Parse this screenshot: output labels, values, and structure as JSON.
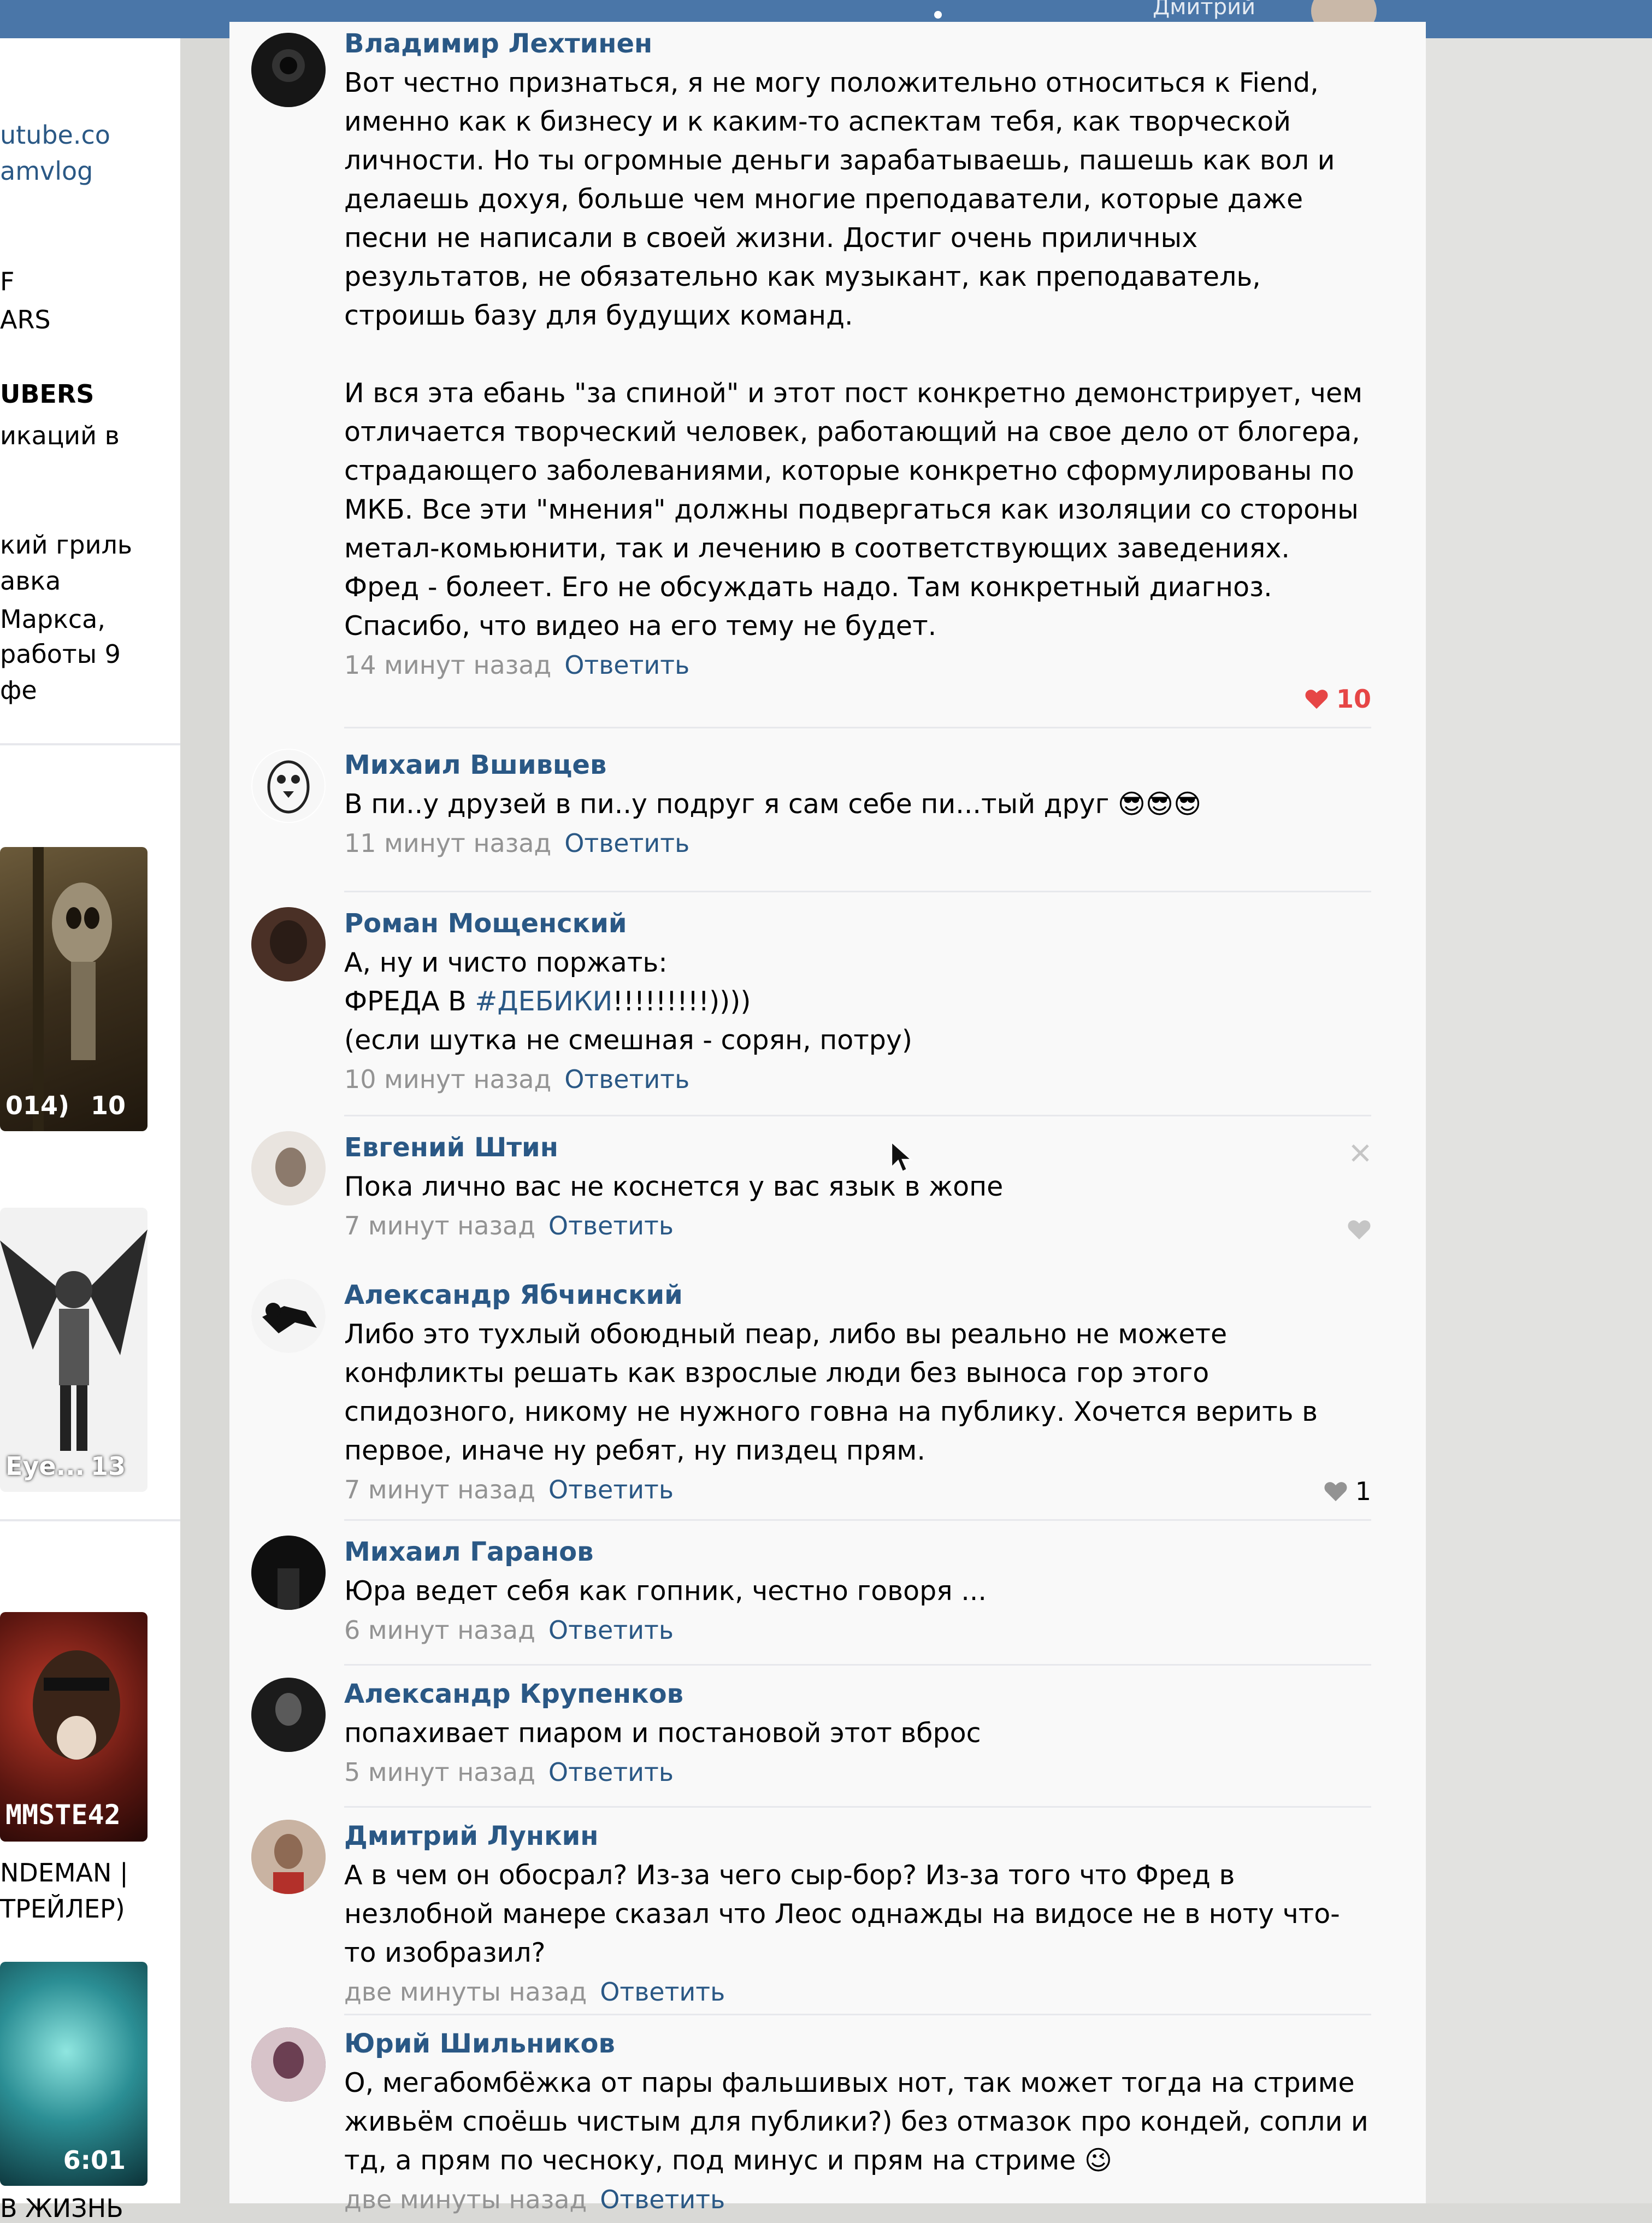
{
  "topbar": {
    "user_name": "Дмитрий"
  },
  "sidebar": {
    "texts": [
      "utube.co",
      "amvlog",
      "F",
      "ARS",
      "UBERS",
      "икаций в",
      "кий гриль",
      "авка",
      " Маркса,",
      " работы 9",
      "фе"
    ],
    "thumbs": [
      {
        "caption": "014)",
        "count": "10"
      },
      {
        "caption": "Eye...",
        "count": "13"
      },
      {
        "caption": "MMSTE42",
        "count": ""
      },
      {
        "caption": "",
        "count": "6:01"
      }
    ],
    "bottom_texts": [
      "NDEMAN |",
      "ТРЕЙЛЕР)",
      "В ЖИЗНЬ"
    ]
  },
  "comments": [
    {
      "author": "Владимир Лехтинен",
      "paragraphs": [
        "Вот честно признаться, я не могу положительно относиться к Fiend, именно как к бизнесу и к каким-то аспектам тебя, как творческой личности. Но ты огромные деньги зарабатываешь, пашешь как вол и делаешь дохуя, больше чем многие преподаватели, которые даже песни не написали в своей жизни. Достиг очень приличных результатов, не обязательно как музыкант, как преподаватель, строишь базу для будущих команд.",
        "И вся эта ебань \"за спиной\" и этот пост конкретно демонстрирует, чем отличается творческий человек, работающий на свое дело от блогера, страдающего заболеваниями, которые конкретно сформулированы по МКБ. Все эти \"мнения\" должны подвергаться как изоляции со стороны метал-комьюнити, так и лечению в соответствующих заведениях. Фред - болеет. Его не обсуждать надо. Там конкретный диагноз. Спасибо, что видео на его тему не будет."
      ],
      "time": "14 минут назад",
      "reply": "Ответить",
      "likes": "10"
    },
    {
      "author": "Михаил Вшивцев",
      "paragraphs": [
        "В пи..у друзей в пи..у подруг я сам себе пи...тый друг 😎😎😎"
      ],
      "time": "11 минут назад",
      "reply": "Ответить",
      "likes": ""
    },
    {
      "author": "Роман Мощенский",
      "lines": [
        "А, ну и чисто поржать:",
        "ФРЕДА В ",
        "#ДЕБИКИ",
        "!!!!!!!!!))))",
        "(если шутка не смешная - сорян, потру)"
      ],
      "time": "10 минут назад",
      "reply": "Ответить",
      "likes": ""
    },
    {
      "author": "Евгений Штин",
      "paragraphs": [
        "Пока лично вас не коснется у вас язык в жопе"
      ],
      "time": "7 минут назад",
      "reply": "Ответить",
      "likes": ""
    },
    {
      "author": "Александр Ябчинский",
      "paragraphs": [
        "Либо это тухлый обоюдный пеар, либо вы реально не можете конфликты решать как взрослые люди без выноса гор этого спидозного, никому не нужного говна на публику. Хочется верить в первое, иначе ну ребят, ну пиздец прям."
      ],
      "time": "7 минут назад",
      "reply": "Ответить",
      "likes": "1"
    },
    {
      "author": "Михаил Гаранов",
      "paragraphs": [
        "Юра ведет себя как гопник, честно говоря ..."
      ],
      "time": "6 минут назад",
      "reply": "Ответить",
      "likes": ""
    },
    {
      "author": "Александр Крупенков",
      "paragraphs": [
        "попахивает пиаром и постановой этот вброс"
      ],
      "time": "5 минут назад",
      "reply": "Ответить",
      "likes": ""
    },
    {
      "author": "Дмитрий Лункин",
      "paragraphs": [
        "А в чем он обосрал? Из-за чего сыр-бор? Из-за того что Фред в незлобной манере сказал что Леос однажды на видосе не в ноту что-то изобразил?"
      ],
      "time": "две минуты назад",
      "reply": "Ответить",
      "likes": ""
    },
    {
      "author": "Юрий Шильников",
      "paragraphs": [
        "О, мегабомбёжка от пары фальшивых нот, так может тогда на стриме живьём споёшь чистым для публики?) без отмазок про кондей, сопли и тд, а прям по чесноку, под минус и прям на стриме 😉"
      ],
      "time": "две минуты назад",
      "reply": "Ответить",
      "likes": ""
    }
  ],
  "colors": {
    "link": "#2a5885",
    "meta": "#939393",
    "like_active": "#e64646",
    "topbar": "#4a76a8"
  }
}
